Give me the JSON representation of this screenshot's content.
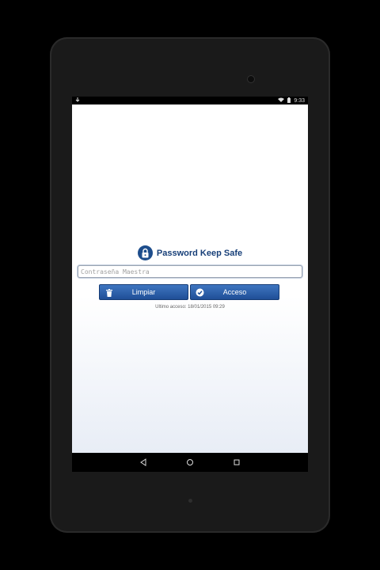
{
  "status_bar": {
    "time": "9:33",
    "icons": [
      "download-icon",
      "wifi-icon",
      "battery-icon"
    ]
  },
  "app": {
    "title": "Password Keep Safe",
    "master_password": {
      "value": "",
      "placeholder": "Contraseña Maestra"
    },
    "buttons": {
      "clear_label": "Limpiar",
      "clear_icon": "trash-icon",
      "access_label": "Acceso",
      "access_icon": "check-circle-icon"
    },
    "last_access": "Ultimo acceso: 18/01/2015 09:29"
  },
  "nav_bar": {
    "items": [
      "back-icon",
      "home-icon",
      "recents-icon"
    ]
  },
  "colors": {
    "brand_blue": "#1d4d8c",
    "button_gradient_top": "#3f75c0",
    "button_gradient_bottom": "#1f4f97"
  }
}
